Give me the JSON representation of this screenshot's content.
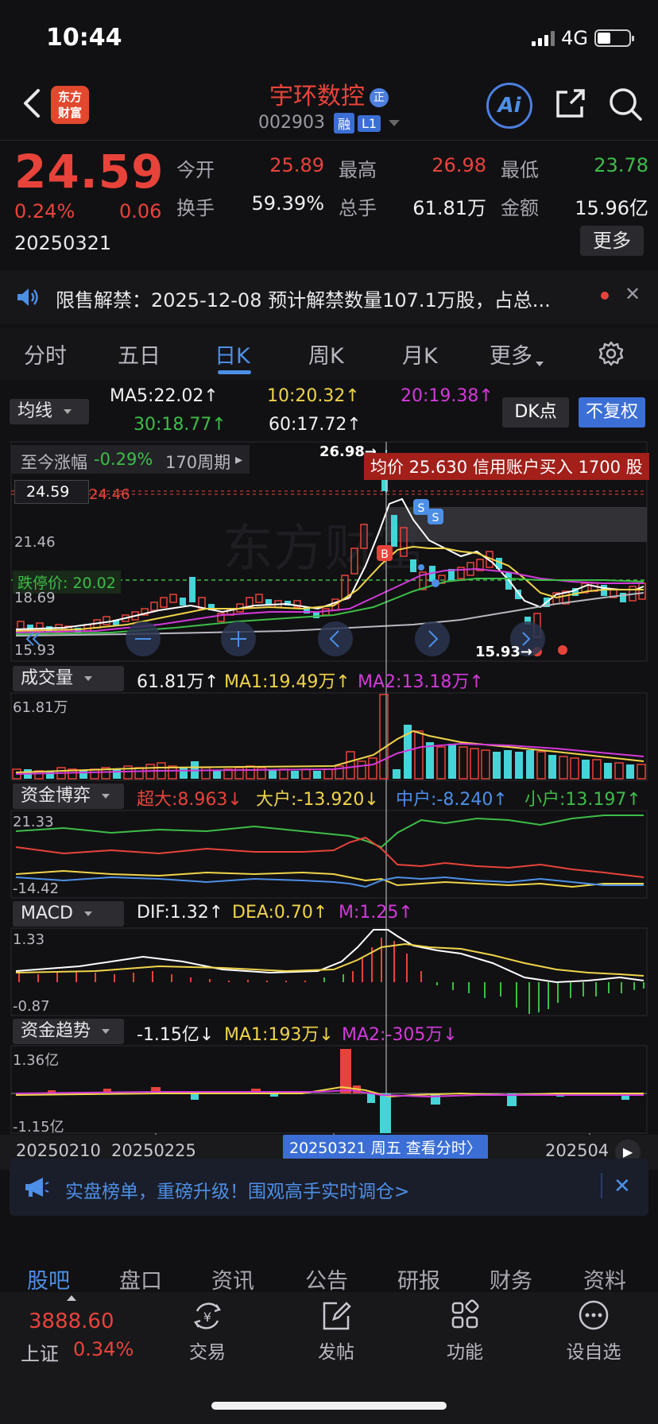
{
  "status": {
    "time": "10:44",
    "network": "4G"
  },
  "header": {
    "logo": "东方财富",
    "name": "宇环数控",
    "name_badge": "正",
    "code": "002903",
    "tags": [
      "融",
      "L1"
    ],
    "ai_label": "Ai"
  },
  "quote": {
    "price": "24.59",
    "change_pct": "0.24%",
    "change": "0.06",
    "date": "20250321",
    "fields": [
      {
        "label": "今开",
        "value": "25.89",
        "color": "#e8433b"
      },
      {
        "label": "最高",
        "value": "26.98",
        "color": "#e8433b"
      },
      {
        "label": "最低",
        "value": "23.78",
        "color": "#3dbd48"
      },
      {
        "label": "换手",
        "value": "59.39%",
        "color": "#f1f1f1"
      },
      {
        "label": "总手",
        "value": "61.81万",
        "color": "#f1f1f1"
      },
      {
        "label": "金额",
        "value": "15.96亿",
        "color": "#f1f1f1"
      }
    ],
    "more": "更多"
  },
  "notice": {
    "text": "限售解禁：2025-12-08 预计解禁数量107.1万股，占总..."
  },
  "tabs": [
    {
      "label": "分时"
    },
    {
      "label": "五日"
    },
    {
      "label": "日K"
    },
    {
      "label": "周K"
    },
    {
      "label": "月K"
    },
    {
      "label": "更多"
    }
  ],
  "kline": {
    "indicator": "均线",
    "ma5": "MA5:22.02↑",
    "ma10": "10:20.32↑",
    "ma20": "20:19.38↑",
    "ma30": "30:18.77↑",
    "ma60": "60:17.72↑",
    "dk": "DK点",
    "adjust": "不复权",
    "since_label": "至今涨幅",
    "since_value": "-0.29%",
    "since_period": "170周期",
    "high_label": "26.98→",
    "low_label": "15.93→",
    "tip": "均价 25.630 信用账户买入 1700 股",
    "price_tag": "24.59",
    "y_top": "24.46",
    "y_2": "21.46",
    "limit_down": "跌停价: 20.02",
    "y_3": "18.69",
    "y_bottom": "15.93"
  },
  "volume": {
    "name": "成交量",
    "v": "61.81万↑",
    "ma1": "MA1:19.49万↑",
    "ma2": "MA2:13.18万↑",
    "y_top": "61.81万"
  },
  "fund": {
    "name": "资金博弈",
    "super": "超大:8.963↓",
    "big": "大户:-13.920↓",
    "mid": "中户:-8.240↑",
    "small": "小户:13.197↑",
    "y_top": "21.33",
    "y_bottom": "-14.42"
  },
  "macd": {
    "name": "MACD",
    "dif": "DIF:1.32↑",
    "dea": "DEA:0.70↑",
    "m": "M:1.25↑",
    "y_top": "1.33",
    "y_bottom": "-0.87"
  },
  "trend": {
    "name": "资金趋势",
    "v": "-1.15亿↓",
    "ma1": "MA1:193万↓",
    "ma2": "MA2:-305万↓",
    "y_top": "1.36亿",
    "y_bottom": "-1.15亿"
  },
  "xaxis": {
    "d1": "20250210",
    "d2": "20250225",
    "d3": "202504",
    "tooltip": "20250321 周五 查看分时〉"
  },
  "promo": {
    "text": "实盘榜单，重磅升级！围观高手实时调仓>"
  },
  "bottom_tabs": [
    {
      "label": "股吧"
    },
    {
      "label": "盘口"
    },
    {
      "label": "资讯"
    },
    {
      "label": "公告"
    },
    {
      "label": "研报"
    },
    {
      "label": "财务"
    },
    {
      "label": "资料"
    }
  ],
  "index": {
    "value": "3888.60",
    "name": "上证",
    "change": "0.34%"
  },
  "nav": [
    {
      "label": "交易",
      "icon": "yen-exchange-icon"
    },
    {
      "label": "发帖",
      "icon": "edit-icon"
    },
    {
      "label": "功能",
      "icon": "grid-icon"
    },
    {
      "label": "设自选",
      "icon": "more-circle-icon"
    }
  ],
  "colors": {
    "up": "#e8433b",
    "down": "#3dbd48",
    "accent": "#4d8fe6"
  }
}
